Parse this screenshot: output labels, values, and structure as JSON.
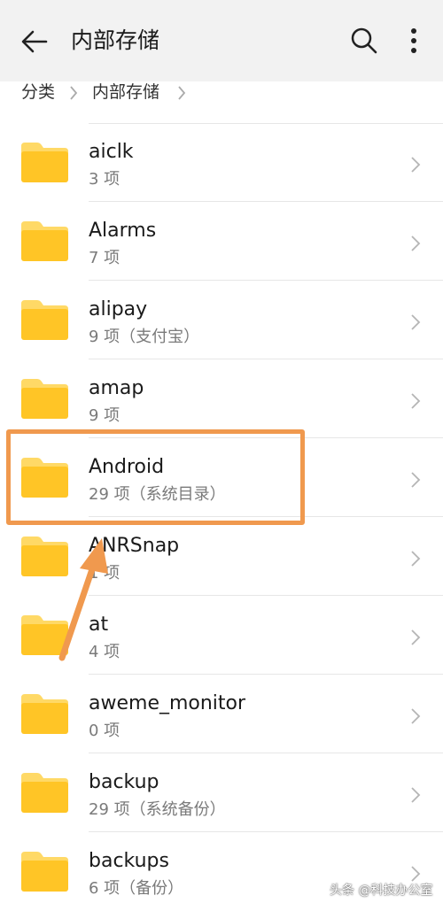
{
  "header": {
    "title": "内部存储"
  },
  "breadcrumb": [
    "分类",
    "内部存储"
  ],
  "items": [
    {
      "name": "aiclk",
      "info": "3 项"
    },
    {
      "name": "Alarms",
      "info": "7 项"
    },
    {
      "name": "alipay",
      "info": "9 项（支付宝）"
    },
    {
      "name": "amap",
      "info": "9 项"
    },
    {
      "name": "Android",
      "info": "29 项（系统目录）"
    },
    {
      "name": "ANRSnap",
      "info": "1 项"
    },
    {
      "name": "at",
      "info": "4 项"
    },
    {
      "name": "aweme_monitor",
      "info": "0 项"
    },
    {
      "name": "backup",
      "info": "29 项（系统备份）"
    },
    {
      "name": "backups",
      "info": "6 项（备份）"
    }
  ],
  "watermark": "头条 @科技办公室",
  "colors": {
    "folder": "#ffc526",
    "folder_tab": "#ffd966",
    "highlight": "#f0994e"
  }
}
